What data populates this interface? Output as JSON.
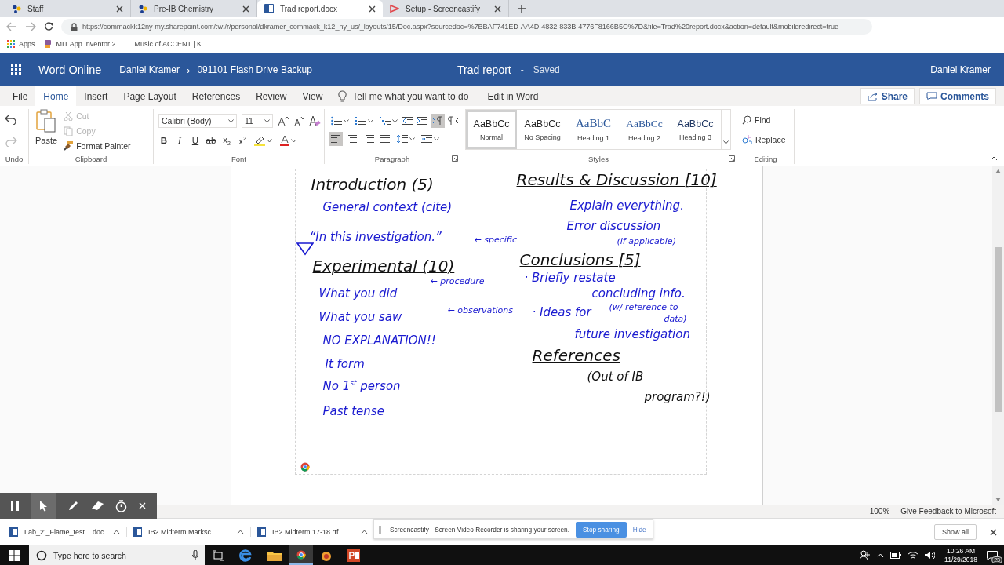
{
  "browser": {
    "tabs": [
      {
        "title": "Staff",
        "selected": false
      },
      {
        "title": "Pre-IB Chemistry",
        "selected": false
      },
      {
        "title": "Trad report.docx",
        "selected": true
      },
      {
        "title": "Setup - Screencastify",
        "selected": false
      }
    ],
    "url": "https://commackk12ny-my.sharepoint.com/:w:/r/personal/dkramer_commack_k12_ny_us/_layouts/15/Doc.aspx?sourcedoc=%7BBAF741ED-AA4D-4832-833B-4776F8166B5C%7D&file=Trad%20report.docx&action=default&mobileredirect=true",
    "bookmarks": [
      "Apps",
      "MIT App Inventor 2",
      "Music of ACCENT | K"
    ]
  },
  "app_header": {
    "app_name": "Word Online",
    "owner": "Daniel Kramer",
    "separator": "›",
    "folder": "091101 Flash Drive Backup",
    "doc_title": "Trad report",
    "dash": "-",
    "save_state": "Saved",
    "user": "Daniel Kramer"
  },
  "ribbon_tabs": [
    {
      "label": "File",
      "selected": false
    },
    {
      "label": "Home",
      "selected": true
    },
    {
      "label": "Insert",
      "selected": false
    },
    {
      "label": "Page Layout",
      "selected": false
    },
    {
      "label": "References",
      "selected": false
    },
    {
      "label": "Review",
      "selected": false
    },
    {
      "label": "View",
      "selected": false
    }
  ],
  "tell_me": "Tell me what you want to do",
  "edit_in_word": "Edit in Word",
  "share": "Share",
  "comments": "Comments",
  "ribbon": {
    "undo_label": "Undo",
    "clipboard": {
      "label": "Clipboard",
      "paste": "Paste",
      "items": [
        {
          "label": "Cut",
          "disabled": true
        },
        {
          "label": "Copy",
          "disabled": true
        },
        {
          "label": "Format Painter",
          "disabled": false
        }
      ]
    },
    "font": {
      "label": "Font",
      "font_name": "Calibri (Body)",
      "font_size": "11",
      "buttons": [
        {
          "kind": "bold",
          "label": "B"
        },
        {
          "kind": "italic",
          "label": "I"
        },
        {
          "kind": "underline",
          "label": "U"
        },
        {
          "kind": "strike",
          "label": "ab"
        },
        {
          "kind": "sub",
          "label": "x$_{2}$"
        },
        {
          "kind": "sup",
          "label": "x$^{2}$"
        }
      ]
    },
    "paragraph": {
      "label": "Paragraph",
      "show_marks": {
        "selected": true
      },
      "align": [
        {
          "selected": true
        },
        {
          "selected": false
        },
        {
          "selected": false
        },
        {
          "selected": false
        }
      ]
    },
    "styles": {
      "label": "Styles",
      "items": [
        {
          "sample": "AaBbCc",
          "name": "Normal",
          "kind": "normal",
          "selected": true
        },
        {
          "sample": "AaBbCc",
          "name": "No Spacing",
          "kind": "normal",
          "selected": false
        },
        {
          "sample": "AaBbC",
          "name": "Heading 1",
          "kind": "h1",
          "selected": false
        },
        {
          "sample": "AaBbCc",
          "name": "Heading 2",
          "kind": "h2",
          "selected": false
        },
        {
          "sample": "AaBbCc",
          "name": "Heading 3",
          "kind": "h3",
          "selected": false
        }
      ]
    },
    "editing": {
      "label": "Editing",
      "find": "Find",
      "replace": "Replace"
    }
  },
  "ink": [
    {
      "text": "Introduction (5)",
      "kind": "heading",
      "color": "#111111"
    },
    {
      "text": "General context (cite)",
      "kind": "note",
      "color": "#1a1ad0"
    },
    {
      "text": "“In this investigation.”",
      "kind": "note",
      "color": "#1a1ad0"
    },
    {
      "text": "← specific",
      "kind": "small",
      "color": "#1a1ad0"
    },
    {
      "text": "Experimental (10)",
      "kind": "heading",
      "color": "#111111"
    },
    {
      "text": "What you did",
      "kind": "note",
      "color": "#1a1ad0"
    },
    {
      "text": "← procedure",
      "kind": "small",
      "color": "#1a1ad0"
    },
    {
      "text": "What you saw",
      "kind": "note",
      "color": "#1a1ad0"
    },
    {
      "text": "← observations",
      "kind": "small",
      "color": "#1a1ad0"
    },
    {
      "text": "NO EXPLANATION!!",
      "kind": "note",
      "color": "#1a1ad0"
    },
    {
      "text": "It form",
      "kind": "note",
      "color": "#1a1ad0"
    },
    {
      "text": "No 1$^{st}$ person",
      "kind": "note",
      "color": "#1a1ad0"
    },
    {
      "text": "Past tense",
      "kind": "note",
      "color": "#1a1ad0"
    },
    {
      "text": "Results & Discussion [10]",
      "kind": "heading",
      "color": "#111111"
    },
    {
      "text": "Explain everything.",
      "kind": "note",
      "color": "#1a1ad0"
    },
    {
      "text": "Error discussion",
      "kind": "note",
      "color": "#1a1ad0"
    },
    {
      "text": "(if applicable)",
      "kind": "small",
      "color": "#1a1ad0"
    },
    {
      "text": "Conclusions [5]",
      "kind": "heading",
      "color": "#111111"
    },
    {
      "text": "· Briefly restate",
      "kind": "note",
      "color": "#1a1ad0"
    },
    {
      "text": "concluding info.",
      "kind": "note",
      "color": "#1a1ad0"
    },
    {
      "text": "(w/ reference to",
      "kind": "small",
      "color": "#1a1ad0"
    },
    {
      "text": "data)",
      "kind": "small",
      "color": "#1a1ad0"
    },
    {
      "text": "· Ideas for",
      "kind": "note",
      "color": "#1a1ad0"
    },
    {
      "text": "future investigation",
      "kind": "note",
      "color": "#1a1ad0"
    },
    {
      "text": "References",
      "kind": "heading",
      "color": "#111111"
    },
    {
      "text": "(Out of IB",
      "kind": "note",
      "color": "#111111"
    },
    {
      "text": "program?!)",
      "kind": "note",
      "color": "#111111"
    }
  ],
  "status_bar": {
    "zoom": "100%",
    "feedback": "Give Feedback to Microsoft"
  },
  "downloads": {
    "items": [
      "Lab_2:_Flame_test....doc",
      "IB2 Midterm Marksc......",
      "IB2 Midterm 17-18.rtf"
    ],
    "show_all": "Show all"
  },
  "share_notice": {
    "message": "Screencastify - Screen Video Recorder is sharing your screen.",
    "stop": "Stop sharing",
    "hide": "Hide"
  },
  "taskbar": {
    "search_placeholder": "Type here to search",
    "time": "10:26 AM",
    "date": "11/29/2018",
    "notifications": "23"
  }
}
